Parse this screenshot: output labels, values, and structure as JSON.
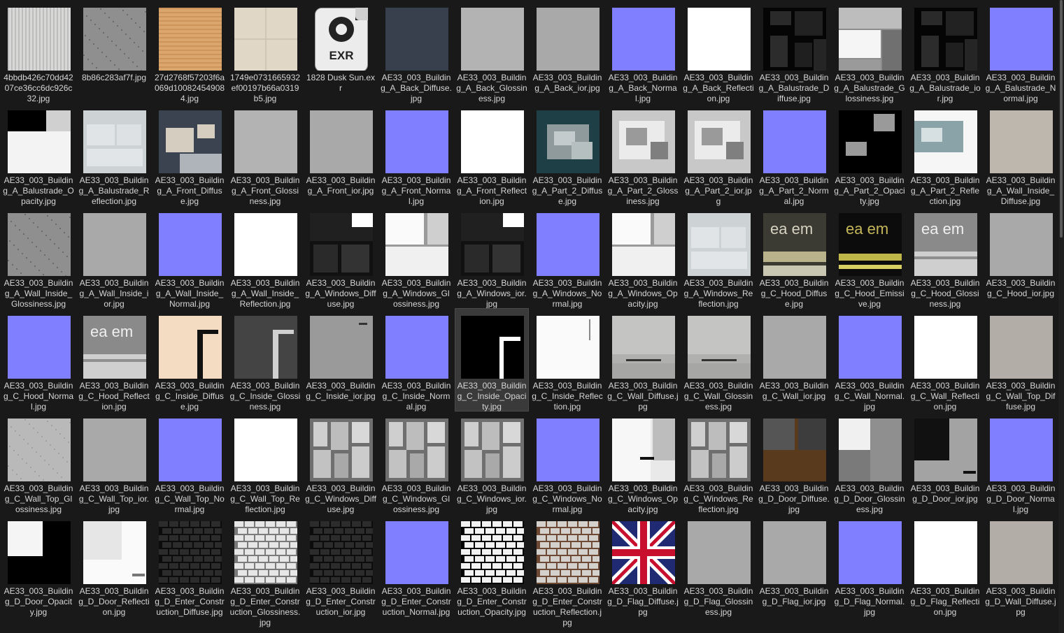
{
  "files": [
    {
      "name": "4bbdb426c70dd4207ce36cc6dc926c32.jpg",
      "thumb": "stripes"
    },
    {
      "name": "8b86c283af7f.jpg",
      "thumb": "noise-gray"
    },
    {
      "name": "27d2768f57203f6a069d100824549084.jpg",
      "thumb": "wood"
    },
    {
      "name": "1749e0731665932ef00197b66a0319b5.jpg",
      "thumb": "tiles-beige"
    },
    {
      "name": "1828 Dusk Sun.exr",
      "thumb": "exr-icon",
      "icon_text": "EXR"
    },
    {
      "name": "AE33_003_Building_A_Back_Diffuse.jpg",
      "thumb": "slate"
    },
    {
      "name": "AE33_003_Building_A_Back_Glossiness.jpg",
      "thumb": "gray-light"
    },
    {
      "name": "AE33_003_Building_A_Back_ior.jpg",
      "thumb": "gray-mid"
    },
    {
      "name": "AE33_003_Building_A_Back_Normal.jpg",
      "thumb": "normal"
    },
    {
      "name": "AE33_003_Building_A_Back_Reflection.jpg",
      "thumb": "white"
    },
    {
      "name": "AE33_003_Building_A_Balustrade_Diffuse.jpg",
      "thumb": "dark-blocks"
    },
    {
      "name": "AE33_003_Building_A_Balustrade_Glossiness.jpg",
      "thumb": "gray-blocks"
    },
    {
      "name": "AE33_003_Building_A_Balustrade_ior.jpg",
      "thumb": "dark-blocks"
    },
    {
      "name": "AE33_003_Building_A_Balustrade_Normal.jpg",
      "thumb": "normal"
    },
    {
      "name": "AE33_003_Building_A_Balustrade_Opacity.jpg",
      "thumb": "opacity-white"
    },
    {
      "name": "AE33_003_Building_A_Balustrade_Reflection.jpg",
      "thumb": "gray-pale"
    },
    {
      "name": "AE33_003_Building_A_Front_Diffuse.jpg",
      "thumb": "front-diffuse"
    },
    {
      "name": "AE33_003_Building_A_Front_Glossiness.jpg",
      "thumb": "gray-light"
    },
    {
      "name": "AE33_003_Building_A_Front_ior.jpg",
      "thumb": "gray-mid"
    },
    {
      "name": "AE33_003_Building_A_Front_Normal.jpg",
      "thumb": "normal"
    },
    {
      "name": "AE33_003_Building_A_Front_Reflection.jpg",
      "thumb": "white"
    },
    {
      "name": "AE33_003_Building_A_Part_2_Diffuse.jpg",
      "thumb": "teal-patches"
    },
    {
      "name": "AE33_003_Building_A_Part_2_Glossiness.jpg",
      "thumb": "gray-patches"
    },
    {
      "name": "AE33_003_Building_A_Part_2_ior.jpg",
      "thumb": "gray-patches"
    },
    {
      "name": "AE33_003_Building_A_Part_2_Normal.jpg",
      "thumb": "normal"
    },
    {
      "name": "AE33_003_Building_A_Part_2_Opacity.jpg",
      "thumb": "black-shapes"
    },
    {
      "name": "AE33_003_Building_A_Part_2_Reflection.jpg",
      "thumb": "teal-white"
    },
    {
      "name": "AE33_003_Building_A_Wall_Inside_Diffuse.jpg",
      "thumb": "beige-plain"
    },
    {
      "name": "AE33_003_Building_A_Wall_Inside_Glossiness.jpg",
      "thumb": "noise-gray"
    },
    {
      "name": "AE33_003_Building_A_Wall_Inside_ior.jpg",
      "thumb": "gray-mid"
    },
    {
      "name": "AE33_003_Building_A_Wall_Inside_Normal.jpg",
      "thumb": "normal"
    },
    {
      "name": "AE33_003_Building_A_Wall_Inside_Reflection.jpg",
      "thumb": "white"
    },
    {
      "name": "AE33_003_Building_A_Windows_Diffuse.jpg",
      "thumb": "dark-windows"
    },
    {
      "name": "AE33_003_Building_A_Windows_Glossiness.jpg",
      "thumb": "white-windows"
    },
    {
      "name": "AE33_003_Building_A_Windows_ior.jpg",
      "thumb": "dark-windows"
    },
    {
      "name": "AE33_003_Building_A_Windows_Normal.jpg",
      "thumb": "normal"
    },
    {
      "name": "AE33_003_Building_A_Windows_Opacity.jpg",
      "thumb": "white-windows"
    },
    {
      "name": "AE33_003_Building_A_Windows_Reflection.jpg",
      "thumb": "gray-pale"
    },
    {
      "name": "AE33_003_Building_C_Hood_Diffuse.jpg",
      "thumb": "hood-text",
      "thumb_text": "ea em"
    },
    {
      "name": "AE33_003_Building_C_Hood_Emissive.jpg",
      "thumb": "hood-emissive",
      "thumb_text": "ea em"
    },
    {
      "name": "AE33_003_Building_C_Hood_Glossiness.jpg",
      "thumb": "hood-gloss",
      "thumb_text": "ea em"
    },
    {
      "name": "AE33_003_Building_C_Hood_ior.jpg",
      "thumb": "gray-mid"
    },
    {
      "name": "AE33_003_Building_C_Hood_Normal.jpg",
      "thumb": "normal"
    },
    {
      "name": "AE33_003_Building_C_Hood_Reflection.jpg",
      "thumb": "hood-gloss",
      "thumb_text": "ea em"
    },
    {
      "name": "AE33_003_Building_C_Inside_Diffuse.jpg",
      "thumb": "peach-inside"
    },
    {
      "name": "AE33_003_Building_C_Inside_Glossiness.jpg",
      "thumb": "dark-inside"
    },
    {
      "name": "AE33_003_Building_C_Inside_ior.jpg",
      "thumb": "gray-inside"
    },
    {
      "name": "AE33_003_Building_C_Inside_Normal.jpg",
      "thumb": "normal"
    },
    {
      "name": "AE33_003_Building_C_Inside_Opacity.jpg",
      "thumb": "black-inside"
    },
    {
      "name": "AE33_003_Building_C_Inside_Reflection.jpg",
      "thumb": "white-inside"
    },
    {
      "name": "AE33_003_Building_C_Wall_Diffuse.jpg",
      "thumb": "wall-gray"
    },
    {
      "name": "AE33_003_Building_C_Wall_Glossiness.jpg",
      "thumb": "wall-gray"
    },
    {
      "name": "AE33_003_Building_C_Wall_ior.jpg",
      "thumb": "gray-mid"
    },
    {
      "name": "AE33_003_Building_C_Wall_Normal.jpg",
      "thumb": "normal"
    },
    {
      "name": "AE33_003_Building_C_Wall_Reflection.jpg",
      "thumb": "white"
    },
    {
      "name": "AE33_003_Building_C_Wall_Top_Diffuse.jpg",
      "thumb": "taupe"
    },
    {
      "name": "AE33_003_Building_C_Wall_Top_Glossiness.jpg",
      "thumb": "noise-light"
    },
    {
      "name": "AE33_003_Building_C_Wall_Top_ior.jpg",
      "thumb": "gray-mid"
    },
    {
      "name": "AE33_003_Building_C_Wall_Top_Normal.jpg",
      "thumb": "normal"
    },
    {
      "name": "AE33_003_Building_C_Wall_Top_Reflection.jpg",
      "thumb": "white"
    },
    {
      "name": "AE33_003_Building_C_Windows_Diffuse.jpg",
      "thumb": "gray-windows"
    },
    {
      "name": "AE33_003_Building_C_Windows_Glossiness.jpg",
      "thumb": "gray-windows"
    },
    {
      "name": "AE33_003_Building_C_Windows_ior.jpg",
      "thumb": "gray-windows"
    },
    {
      "name": "AE33_003_Building_C_Windows_Normal.jpg",
      "thumb": "normal"
    },
    {
      "name": "AE33_003_Building_C_Windows_Opacity.jpg",
      "thumb": "opacity-windows"
    },
    {
      "name": "AE33_003_Building_C_Windows_Reflection.jpg",
      "thumb": "gray-windows"
    },
    {
      "name": "AE33_003_Building_D_Door_Diffuse.jpg",
      "thumb": "door-wood"
    },
    {
      "name": "AE33_003_Building_D_Door_Glossiness.jpg",
      "thumb": "door-gloss"
    },
    {
      "name": "AE33_003_Building_D_Door_ior.jpg",
      "thumb": "door-ior"
    },
    {
      "name": "AE33_003_Building_D_Door_Normal.jpg",
      "thumb": "normal"
    },
    {
      "name": "AE33_003_Building_D_Door_Opacity.jpg",
      "thumb": "door-opacity"
    },
    {
      "name": "AE33_003_Building_D_Door_Reflection.jpg",
      "thumb": "door-refl"
    },
    {
      "name": "AE33_003_Building_D_Enter_Construction_Diffuse.jpg",
      "thumb": "bricks-dark"
    },
    {
      "name": "AE33_003_Building_D_Enter_Construction_Glossiness.jpg",
      "thumb": "bricks-light"
    },
    {
      "name": "AE33_003_Building_D_Enter_Construction_ior.jpg",
      "thumb": "bricks-dark"
    },
    {
      "name": "AE33_003_Building_D_Enter_Construction_Normal.jpg",
      "thumb": "normal"
    },
    {
      "name": "AE33_003_Building_D_Enter_Construction_Opacity.jpg",
      "thumb": "bricks-bw"
    },
    {
      "name": "AE33_003_Building_D_Enter_Construction_Reflection.jpg",
      "thumb": "bricks-brown"
    },
    {
      "name": "AE33_003_Building_D_Flag_Diffuse.jpg",
      "thumb": "union-flag"
    },
    {
      "name": "AE33_003_Building_D_Flag_Glossiness.jpg",
      "thumb": "gray-mid"
    },
    {
      "name": "AE33_003_Building_D_Flag_ior.jpg",
      "thumb": "gray-mid"
    },
    {
      "name": "AE33_003_Building_D_Flag_Normal.jpg",
      "thumb": "normal"
    },
    {
      "name": "AE33_003_Building_D_Flag_Reflection.jpg",
      "thumb": "white"
    },
    {
      "name": "AE33_003_Building_D_Wall_Diffuse.jpg",
      "thumb": "taupe"
    }
  ],
  "selected_index": 48,
  "colors": {
    "background": "#191919",
    "selection": "#3a3a3a",
    "label": "#d6d6d6",
    "normal_map": "#7f7fff"
  }
}
